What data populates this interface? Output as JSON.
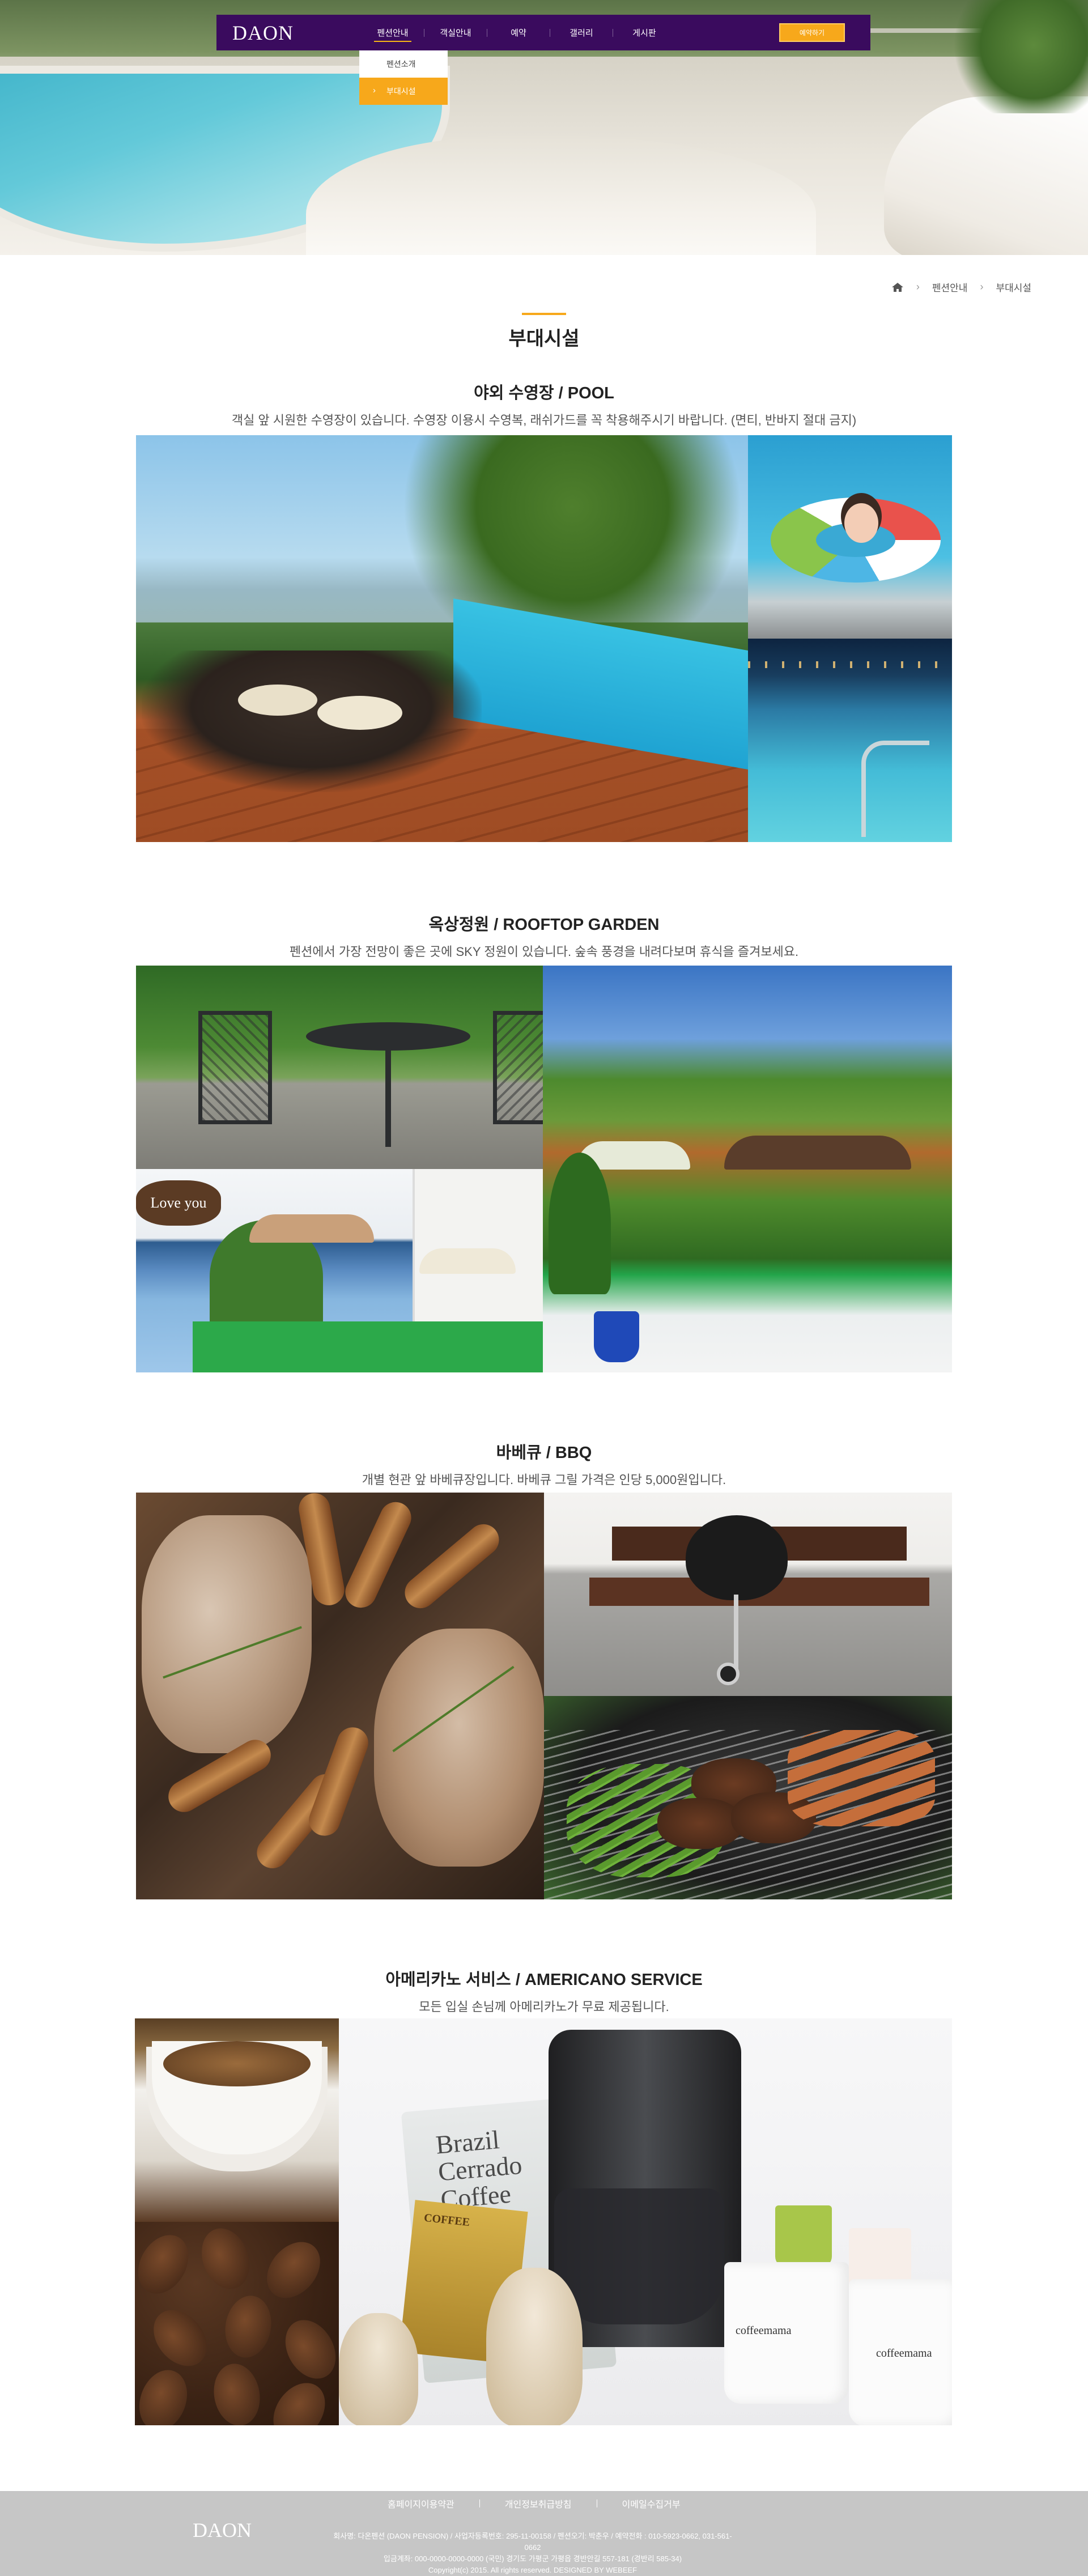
{
  "nav": {
    "logo": "DAON",
    "menu": [
      {
        "label": "펜션안내",
        "active": true
      },
      {
        "label": "객실안내",
        "active": false
      },
      {
        "label": "예약",
        "active": false
      },
      {
        "label": "갤러리",
        "active": false
      },
      {
        "label": "게시판",
        "active": false
      }
    ],
    "reserve_label": "예약하기",
    "dropdown": [
      {
        "label": "펜션소개",
        "active": false
      },
      {
        "label": "부대시설",
        "active": true
      }
    ],
    "accent_color": "#f7a81b",
    "bar_color": "#3a0b5e"
  },
  "breadcrumb": {
    "home_icon": "home-icon",
    "items": [
      "펜션안내",
      "부대시설"
    ]
  },
  "page_title": "부대시설",
  "sections": {
    "pool": {
      "title": "야외 수영장 / POOL",
      "desc": "객실 앞 시원한 수영장이 있습니다. 수영장 이용시 수영복, 래쉬가드를 꼭 착용해주시기 바랍니다. (면티, 반바지 절대 금지)"
    },
    "garden": {
      "title": "옥상정원 / ROOFTOP GARDEN",
      "desc": "펜션에서 가장 전망이 좋은 곳에 SKY 정원이 있습니다. 숲속 풍경을 내려다보며 휴식을 즐겨보세요.",
      "sign_text": "Love you"
    },
    "bbq": {
      "title": "바베큐 / BBQ",
      "desc": "개별 현관 앞 바베큐장입니다. 바베큐 그릴 가격은 인당 5,000원입니다."
    },
    "coffee": {
      "title": "아메리카노 서비스 / AMERICANO SERVICE",
      "desc": "모든 입실 손님께 아메리카노가 무료 제공됩니다.",
      "bag_text": "Brazil Cerrado Coffee",
      "gold_bag_text": "COFFEE",
      "mug_text": "coffeemama"
    }
  },
  "footer": {
    "logo": "DAON",
    "links": [
      "홈페이지이용약관",
      "개인정보취급방침",
      "이메일수집거부"
    ],
    "info_line1": "회사명: 다온펜션 (DAON PENSION) / 사업자등록번호: 295-11-00158 / 펜션오기: 박춘우 / 예약전화 : 010-5923-0662, 031-561-0662",
    "info_line2": "입금계좌: 000-0000-0000-0000 (국민) 경기도 가평군 가평읍 경반안길 557-181 (경반리 585-34)",
    "copyright": "Copyright(c) 2015. All rights reserved. DESIGNED BY WEBEEF"
  }
}
